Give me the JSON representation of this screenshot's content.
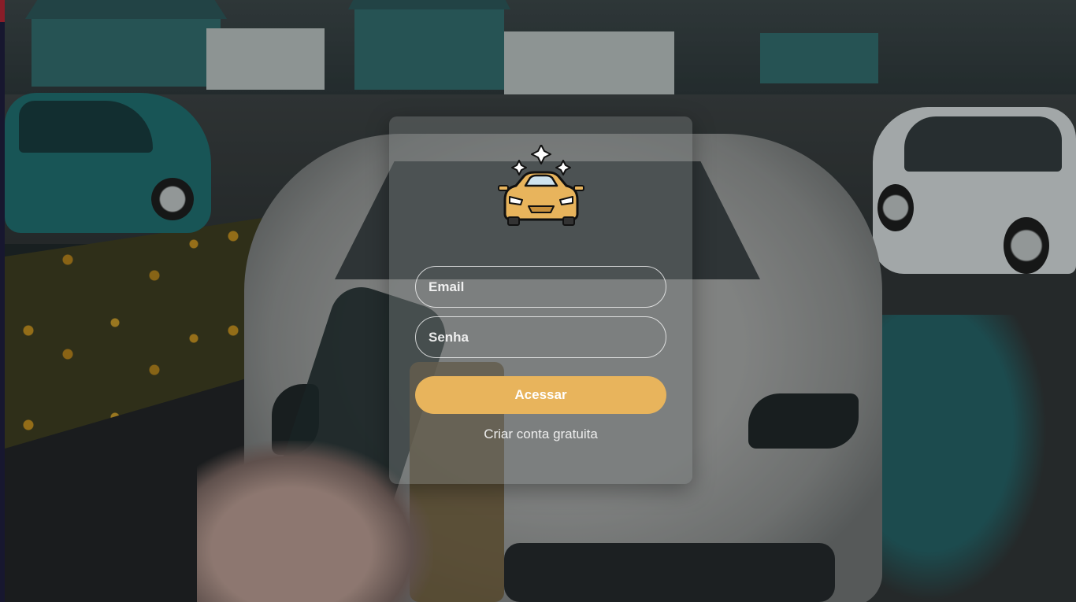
{
  "login": {
    "logo_icon": "car-wash-icon",
    "email_placeholder": "Email",
    "senha_placeholder": "Senha",
    "submit_label": "Acessar",
    "signup_label": "Criar conta gratuita"
  },
  "colors": {
    "accent": "#e8b45c",
    "card_background": "rgba(120,125,125,0.42)",
    "text": "#ffffff"
  },
  "background": {
    "image_subject": "car-wash-photo"
  }
}
